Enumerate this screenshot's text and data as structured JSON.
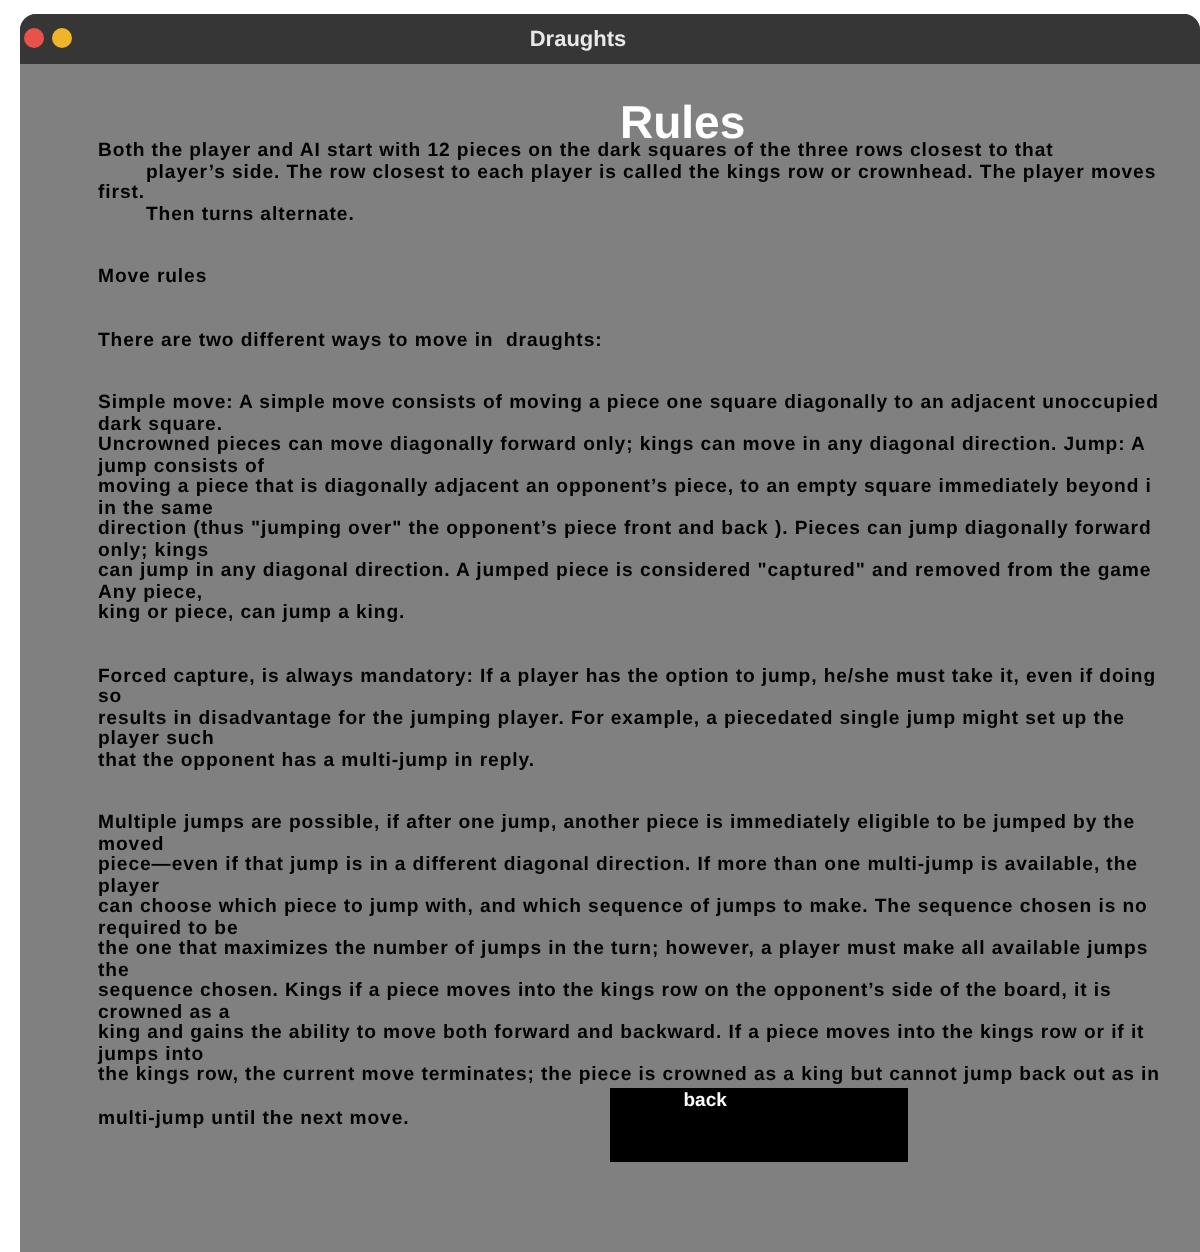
{
  "window": {
    "title": "Draughts"
  },
  "heading": "Rules",
  "paragraphs": [
    {
      "lines": [
        {
          "text": "Both the player and AI start with 12 pieces on the dark squares of the three rows closest to that",
          "indent": false
        },
        {
          "text": "player’s side. The row closest to each player is called the kings row or crownhead. The player moves",
          "indent": true
        },
        {
          "text": "first.",
          "indent": false
        },
        {
          "text": "Then turns alternate.",
          "indent": true
        }
      ]
    },
    {
      "lines": [
        {
          "text": "Move rules",
          "indent": false
        }
      ]
    },
    {
      "lines": [
        {
          "text": "There are two different ways to move in  draughts:",
          "indent": false
        }
      ]
    },
    {
      "lines": [
        {
          "text": "Simple move: A simple move consists of moving a piece one square diagonally to an adjacent unoccupied",
          "indent": false
        },
        {
          "text": "dark square.",
          "indent": false
        },
        {
          "text": "Uncrowned pieces can move diagonally forward only; kings can move in any diagonal direction. Jump: A",
          "indent": false
        },
        {
          "text": "jump consists of",
          "indent": false
        },
        {
          "text": "moving a piece that is diagonally adjacent an opponent’s piece, to an empty square immediately beyond i",
          "indent": false
        },
        {
          "text": "in the same",
          "indent": false
        },
        {
          "text": "direction (thus \"jumping over\" the opponent’s piece front and back ). Pieces can jump diagonally forward",
          "indent": false
        },
        {
          "text": "only; kings",
          "indent": false
        },
        {
          "text": "can jump in any diagonal direction. A jumped piece is considered \"captured\" and removed from the game",
          "indent": false
        },
        {
          "text": "Any piece,",
          "indent": false
        },
        {
          "text": "king or piece, can jump a king.",
          "indent": false
        }
      ]
    },
    {
      "lines": [
        {
          "text": "Forced capture, is always mandatory: If a player has the option to jump, he/she must take it, even if doing",
          "indent": false
        },
        {
          "text": "so",
          "indent": false
        },
        {
          "text": "results in disadvantage for the jumping player. For example, a piecedated single jump might set up the",
          "indent": false
        },
        {
          "text": "player such",
          "indent": false
        },
        {
          "text": "that the opponent has a multi-jump in reply.",
          "indent": false
        }
      ]
    },
    {
      "lines": [
        {
          "text": "Multiple jumps are possible, if after one jump, another piece is immediately eligible to be jumped by the",
          "indent": false
        },
        {
          "text": "moved",
          "indent": false
        },
        {
          "text": "piece—even if that jump is in a different diagonal direction. If more than one multi-jump is available, the",
          "indent": false
        },
        {
          "text": "player",
          "indent": false
        },
        {
          "text": "can choose which piece to jump with, and which sequence of jumps to make. The sequence chosen is no",
          "indent": false
        },
        {
          "text": "required to be",
          "indent": false
        },
        {
          "text": "the one that maximizes the number of jumps in the turn; however, a player must make all available jumps",
          "indent": false
        },
        {
          "text": "the",
          "indent": false
        },
        {
          "text": "sequence chosen. Kings if a piece moves into the kings row on the opponent’s side of the board, it is",
          "indent": false
        },
        {
          "text": "crowned as a",
          "indent": false
        },
        {
          "text": "king and gains the ability to move both forward and backward. If a piece moves into the kings row or if it",
          "indent": false
        },
        {
          "text": "jumps into",
          "indent": false
        },
        {
          "text": "the kings row, the current move terminates; the piece is crowned as a king but cannot jump back out as in",
          "indent": false
        },
        {
          "text": "multi-jump until the next move.",
          "indent": false
        }
      ]
    }
  ],
  "back_button": {
    "label": "back"
  }
}
